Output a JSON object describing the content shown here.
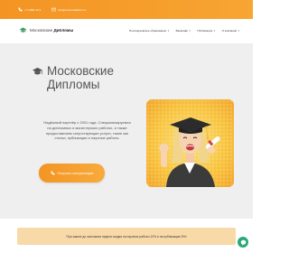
{
  "topbar": {
    "phone": "+7 (495) 12-3",
    "email": "info@moscowdiplom.ru"
  },
  "brand": {
    "part1": "Московские",
    "part2": "Дипломы"
  },
  "menu": [
    {
      "label": "Послевузовское образование",
      "dropdown": true
    },
    {
      "label": "Бакалавр",
      "dropdown": true
    },
    {
      "label": "Публикации",
      "dropdown": true
    },
    {
      "label": "О компании",
      "dropdown": true
    }
  ],
  "hero": {
    "title_line1": "Московские",
    "title_line2": "Дипломы",
    "description": "Надёжный партнёр с 2001 года. Специализируемся на дипломных и магистерских работах, а также предоставляем сопутствующие услуги, такие как статьи, публикации и научные работы.",
    "cta_label": "Получить консультацию"
  },
  "promo": {
    "text": "При заказе до окончания недели скидка на научные работы 10% и на публикацию 5%!"
  },
  "colors": {
    "accent": "#f49423",
    "promo_bg": "#f8d9a8",
    "chat": "#2aa877"
  }
}
